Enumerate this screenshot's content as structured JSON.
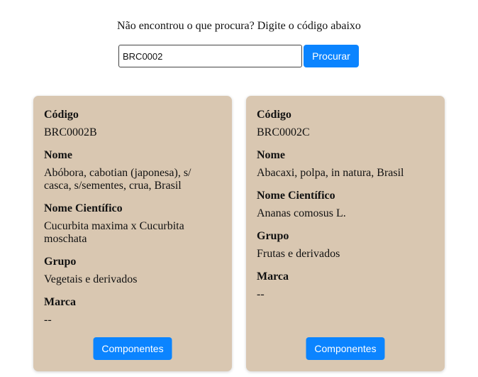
{
  "search": {
    "prompt": "Não encontrou o que procura? Digite o código abaixo",
    "value": "BRC0002",
    "button_label": "Procurar"
  },
  "labels": {
    "code": "Código",
    "name": "Nome",
    "scientific_name": "Nome Científico",
    "group": "Grupo",
    "brand": "Marca"
  },
  "cards": [
    {
      "code": "BRC0002B",
      "name": "Abóbora, cabotian (japonesa), s/ casca, s/sementes, crua, Brasil",
      "scientific_name": "Cucurbita maxima x Cucurbita moschata",
      "group": "Vegetais e derivados",
      "brand": "--",
      "button_label": "Componentes"
    },
    {
      "code": "BRC0002C",
      "name": "Abacaxi, polpa, in natura, Brasil",
      "scientific_name": "Ananas comosus L.",
      "group": "Frutas e derivados",
      "brand": "--",
      "button_label": "Componentes"
    }
  ],
  "colors": {
    "card_background": "#d9c7b1",
    "button_blue": "#0b84ff"
  }
}
